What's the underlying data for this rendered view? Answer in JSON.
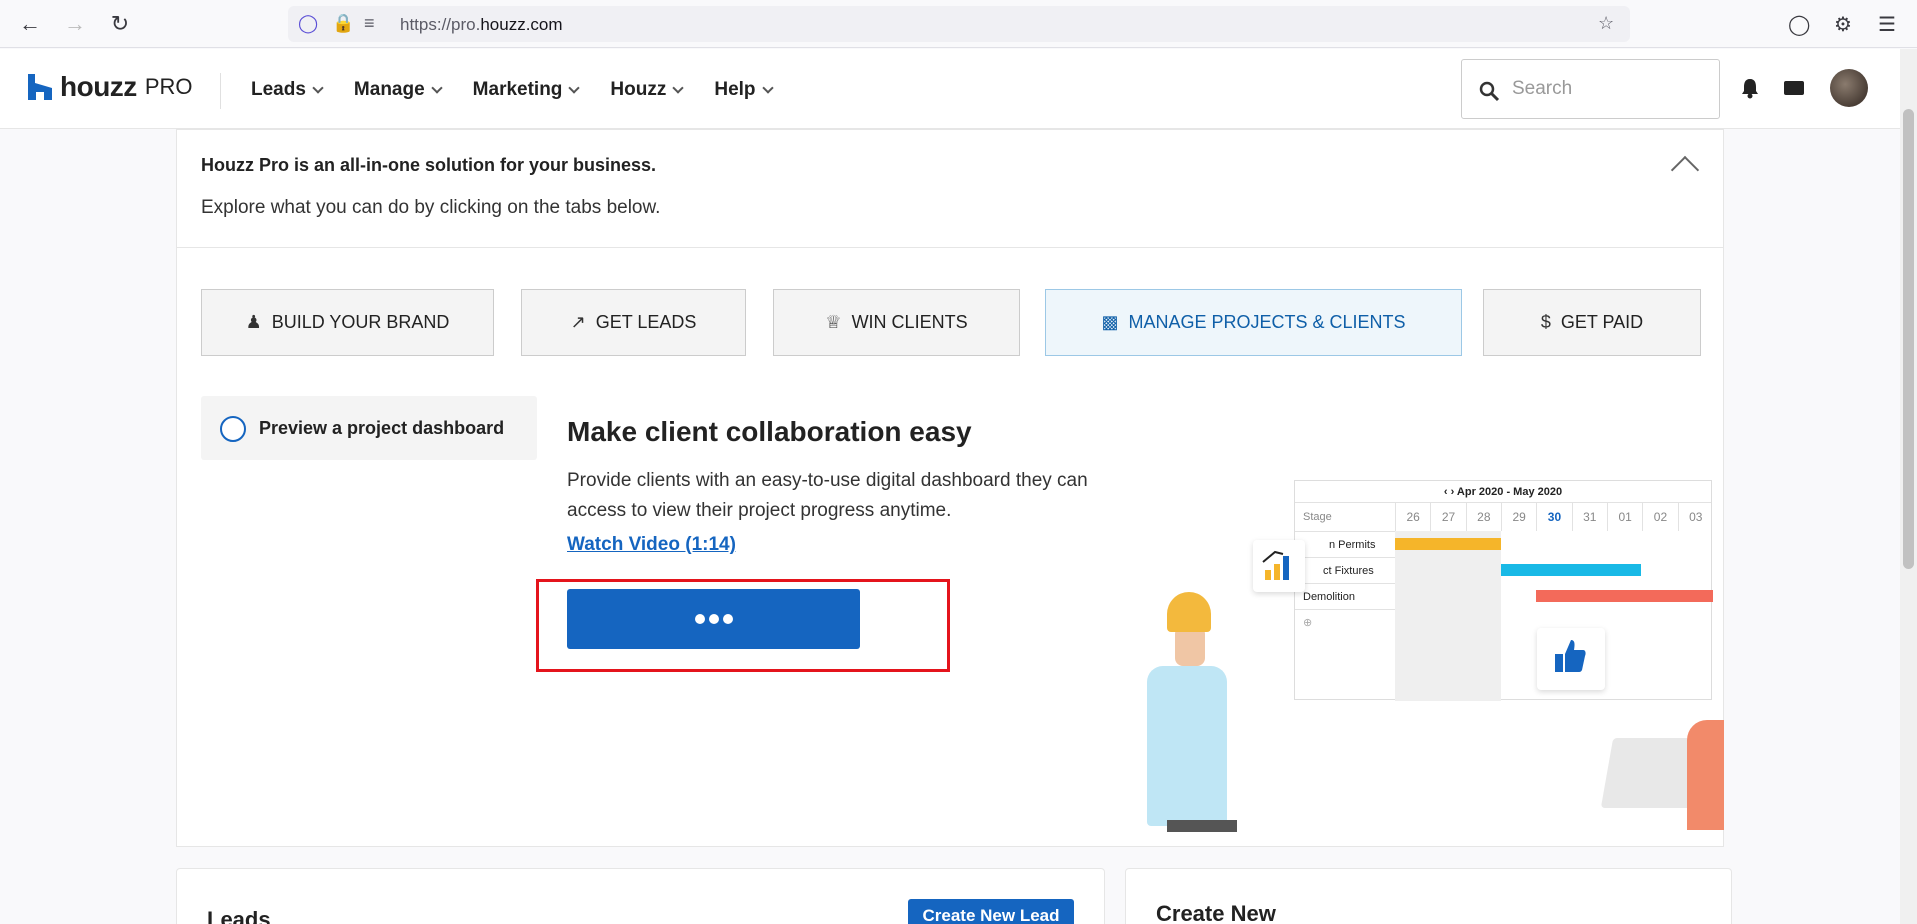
{
  "browser": {
    "url_prefix": "https://pro.",
    "url_domain": "houzz.com"
  },
  "header": {
    "logo_text": "houzz",
    "logo_pro": "PRO",
    "nav": [
      {
        "label": "Leads"
      },
      {
        "label": "Manage"
      },
      {
        "label": "Marketing"
      },
      {
        "label": "Houzz"
      },
      {
        "label": "Help"
      }
    ],
    "search_placeholder": "Search"
  },
  "intro": {
    "title": "Houzz Pro is an all-in-one solution for your business.",
    "subtitle": "Explore what you can do by clicking on the tabs below."
  },
  "tabs": [
    {
      "label": "BUILD YOUR BRAND",
      "icon": "person-icon"
    },
    {
      "label": "GET LEADS",
      "icon": "trending-up-icon"
    },
    {
      "label": "WIN CLIENTS",
      "icon": "trophy-icon"
    },
    {
      "label": "MANAGE PROJECTS & CLIENTS",
      "icon": "briefcase-icon",
      "active": true
    },
    {
      "label": "GET PAID",
      "icon": "dollar-icon"
    }
  ],
  "feature": {
    "option_label": "Preview a project dashboard",
    "headline": "Make client collaboration easy",
    "description": "Provide clients with an easy-to-use digital dashboard they can access to view their project progress anytime.",
    "video_link": "Watch Video (1:14)"
  },
  "illustration": {
    "gantt_range": "Apr 2020 - May 2020",
    "stage_header": "Stage",
    "days": [
      "26",
      "27",
      "28",
      "29",
      "30",
      "31",
      "01",
      "02",
      "03"
    ],
    "today": "30",
    "rows": [
      "n Permits",
      "ct Fixtures",
      "Demolition"
    ]
  },
  "lower": {
    "leads_title": "Leads",
    "create_lead_button": "Create New Lead",
    "create_new_title": "Create New"
  },
  "colors": {
    "brand_blue": "#1565c0",
    "highlight_red": "#e4141c",
    "bar_yellow": "#f5b52a",
    "bar_cyan": "#19b9e6",
    "bar_red": "#f36a5a"
  }
}
